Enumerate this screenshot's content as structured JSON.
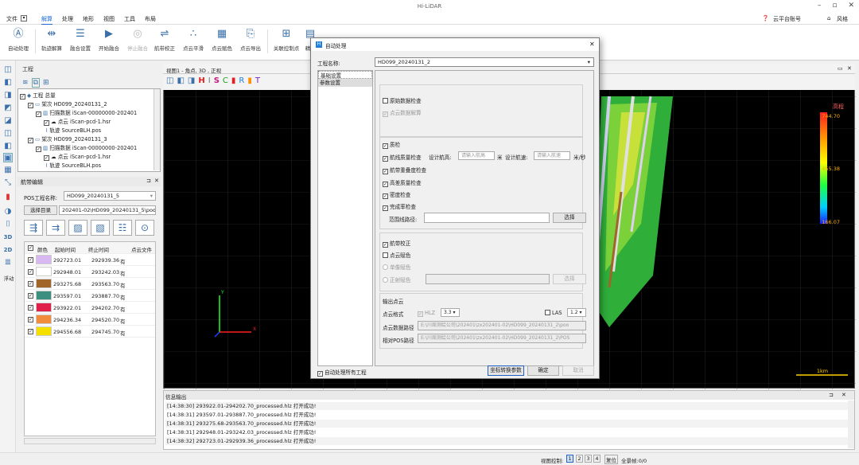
{
  "app": {
    "title": "Hi-LiDAR",
    "window_controls": [
      "–",
      "▫",
      "✕"
    ]
  },
  "menu": {
    "file": "文件",
    "items": [
      "解算",
      "处理",
      "地形",
      "视图",
      "工具",
      "布局"
    ],
    "account": "云平台账号",
    "style": "风格"
  },
  "ribbon": {
    "buttons": [
      {
        "label": "自动处理",
        "icon": "auto-process-icon",
        "enabled": true
      },
      {
        "label": "轨迹解算",
        "icon": "trajectory-icon",
        "enabled": true
      },
      {
        "label": "融合设置",
        "icon": "fusion-settings-icon",
        "enabled": true
      },
      {
        "label": "开始融合",
        "icon": "play-icon",
        "enabled": true
      },
      {
        "label": "停止融合",
        "icon": "stop-icon",
        "enabled": false
      },
      {
        "label": "航带校正",
        "icon": "strip-adjust-icon",
        "enabled": true
      },
      {
        "label": "点云平滑",
        "icon": "smooth-icon",
        "enabled": true
      },
      {
        "label": "点云赋色",
        "icon": "colorize-icon",
        "enabled": true
      },
      {
        "label": "点云导出",
        "icon": "export-icon",
        "enabled": true
      },
      {
        "label": "关联控制点",
        "icon": "control-point-icon",
        "enabled": true
      },
      {
        "label": "精",
        "icon": "precision-icon",
        "enabled": true
      }
    ]
  },
  "project": {
    "header": "工程",
    "tree": [
      {
        "text": "工程 总量",
        "level": 0
      },
      {
        "text": "架次 HD099_20240131_2",
        "level": 1
      },
      {
        "text": "扫描数据  iScan-00000000-202401",
        "level": 2
      },
      {
        "text": "点云  iScan-pcd-1.hsr",
        "level": 3
      },
      {
        "text": "轨迹 SourceBLH.pos",
        "level": 2
      },
      {
        "text": "架次 HD099_20240131_3",
        "level": 1
      },
      {
        "text": "扫描数据  iScan-00000000-202401",
        "level": 2
      },
      {
        "text": "点云  iScan-pcd-1.hsr",
        "level": 3
      },
      {
        "text": "轨迹 SourceBLH.pos",
        "level": 2
      }
    ]
  },
  "pos_editor": {
    "header": "航带编辑",
    "project_label": "POS工程名称:",
    "project_value": "HD099_20240131_5",
    "dir_button": "选择目录",
    "dir_value": "202401-02\\HD099_20240131_5\\poo",
    "columns": [
      "颜色",
      "起始时间",
      "终止时间",
      "点云文件"
    ],
    "rows": [
      {
        "color": "#d7b8f0",
        "start": "292723.01",
        "end": "292939.36",
        "file": "有"
      },
      {
        "color": "#ffffff",
        "start": "292948.01",
        "end": "293242.03",
        "file": "有"
      },
      {
        "color": "#a0662a",
        "start": "293275.68",
        "end": "293563.70",
        "file": "有"
      },
      {
        "color": "#3d8f80",
        "start": "293597.01",
        "end": "293887.70",
        "file": "有"
      },
      {
        "color": "#e0204a",
        "start": "293922.01",
        "end": "294202.70",
        "file": "有"
      },
      {
        "color": "#f08c3c",
        "start": "294236.34",
        "end": "294520.70",
        "file": "有"
      },
      {
        "color": "#f5e000",
        "start": "294556.68",
        "end": "294745.70",
        "file": "有"
      }
    ]
  },
  "left_tools": [
    "3D",
    "2D",
    "浮动"
  ],
  "viewport": {
    "header": "视图1 - 角点, 3D , 正视",
    "legend_title": "高程",
    "legend_values": [
      "744.70",
      "455.38",
      "166.07"
    ],
    "scale": "1km"
  },
  "console": {
    "header": "信息输出",
    "lines": [
      "[14:38:30] 293922.01-294202.70_processed.hlz 打开成功!",
      "[14:38:31] 293597.01-293887.70_processed.hlz 打开成功!",
      "[14:38:31] 293275.68-293563.70_processed.hlz 打开成功!",
      "[14:38:31] 292948.01-293242.03_processed.hlz 打开成功!",
      "[14:38:32] 292723.01-292939.36_processed.hlz 打开成功!"
    ]
  },
  "status": {
    "label": "视图控制:",
    "pages": [
      "1",
      "2",
      "3",
      "4"
    ],
    "reset": "复位",
    "extra": "全景帧:0/0"
  },
  "dialog": {
    "title": "自动处理",
    "project_label": "工程名称:",
    "project_value": "HD099_20240131_2",
    "nav": [
      "基础设置",
      "参数设置"
    ],
    "raw_check": "原始数据检查",
    "pc_solve": "点云数据解算",
    "qc": "质检",
    "track_qc": "航线质量检查",
    "design_alt": "设计航高:",
    "alt_ph": "请输入航高",
    "unit_m": "米",
    "design_speed": "设计航速:",
    "speed_ph": "请输入航速",
    "unit_speed": "米/秒",
    "overlap": "航带重叠度检查",
    "elev_qc": "高差质量检查",
    "density": "密度检查",
    "completeness": "完成率检查",
    "range_label": "范围线路径:",
    "select": "选择",
    "strip_adjust": "航带校正",
    "pc_color": "点云赋色",
    "single_color": "单像赋色",
    "ortho_color": "正射赋色",
    "output": "输出点云",
    "format_label": "点云格式",
    "hlz": "HLZ",
    "hlz_ver": "3.3",
    "las": "LAS",
    "las_ver": "1.2",
    "out_path_label": "点云数据路径",
    "out_path": "E:\\川周测绘公司\\202401\\zx202401-02\\HD099_20240131_2\\poo",
    "pos_path_label": "相对POS路径",
    "pos_path": "E:\\川周测绘公司\\202401\\zx202401-02\\HD099_20240131_2\\POS",
    "auto_all": "自动处理所有工程",
    "coord_btn": "坐标转换参数",
    "ok": "确定",
    "cancel": "取消"
  }
}
